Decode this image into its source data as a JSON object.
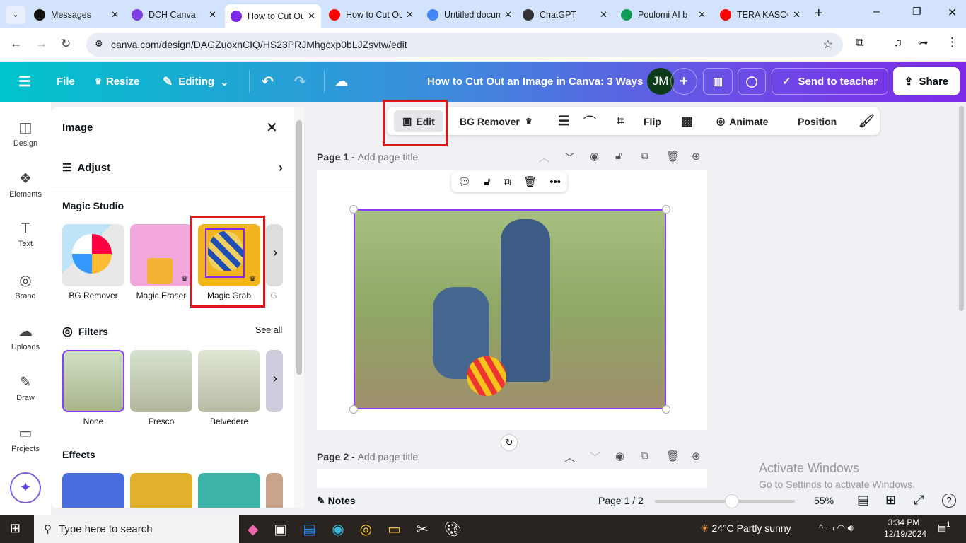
{
  "browser": {
    "tabs": [
      {
        "title": "Messages",
        "color": "#111"
      },
      {
        "title": "DCH Canva",
        "color": "#7b3fe4"
      },
      {
        "title": "How to Cut Out",
        "color": "#7d2ae8"
      },
      {
        "title": "How to Cut Out",
        "color": "#ff0000"
      },
      {
        "title": "Untitled document",
        "color": "#4285f4"
      },
      {
        "title": "ChatGPT",
        "color": "#333"
      },
      {
        "title": "Poulomi AI b",
        "color": "#0f9d58"
      },
      {
        "title": "TERA KASOO",
        "color": "#ff0000"
      }
    ],
    "active_tab": 2,
    "url": "canva.com/design/DAGZuoxnCIQ/HS23PRJMhgcxp0bLJZsvtw/edit"
  },
  "header": {
    "file": "File",
    "resize": "Resize",
    "editing": "Editing",
    "title": "How to Cut Out an Image in Canva: 3 Ways",
    "avatar": "JM",
    "send": "Send to teacher",
    "share": "Share"
  },
  "rail": [
    {
      "label": "Design",
      "icon": "design-icon"
    },
    {
      "label": "Elements",
      "icon": "elements-icon"
    },
    {
      "label": "Text",
      "icon": "text-icon"
    },
    {
      "label": "Brand",
      "icon": "brand-icon"
    },
    {
      "label": "Uploads",
      "icon": "uploads-icon"
    },
    {
      "label": "Draw",
      "icon": "draw-icon"
    },
    {
      "label": "Projects",
      "icon": "projects-icon"
    }
  ],
  "panel": {
    "title": "Image",
    "adjust": "Adjust",
    "magic_studio": "Magic Studio",
    "magic": [
      "BG Remover",
      "Magic Eraser",
      "Magic Grab",
      "G"
    ],
    "filters": "Filters",
    "see_all": "See all",
    "filter_items": [
      "None",
      "Fresco",
      "Belvedere"
    ],
    "effects": "Effects"
  },
  "toolbar": {
    "edit": "Edit",
    "bg_remover": "BG Remover",
    "flip": "Flip",
    "animate": "Animate",
    "position": "Position"
  },
  "pages": [
    {
      "label": "Page 1 -",
      "placeholder": "Add page title"
    },
    {
      "label": "Page 2 -",
      "placeholder": "Add page title"
    }
  ],
  "bottom": {
    "notes": "Notes",
    "page": "Page 1 / 2",
    "zoom": "55%",
    "zoom_value": 55
  },
  "watermark": {
    "title": "Activate Windows",
    "sub": "Go to Settings to activate Windows."
  },
  "taskbar": {
    "search": "Type here to search",
    "weather": "24°C  Partly sunny",
    "time": "3:34 PM",
    "date": "12/19/2024",
    "notif": "1"
  }
}
